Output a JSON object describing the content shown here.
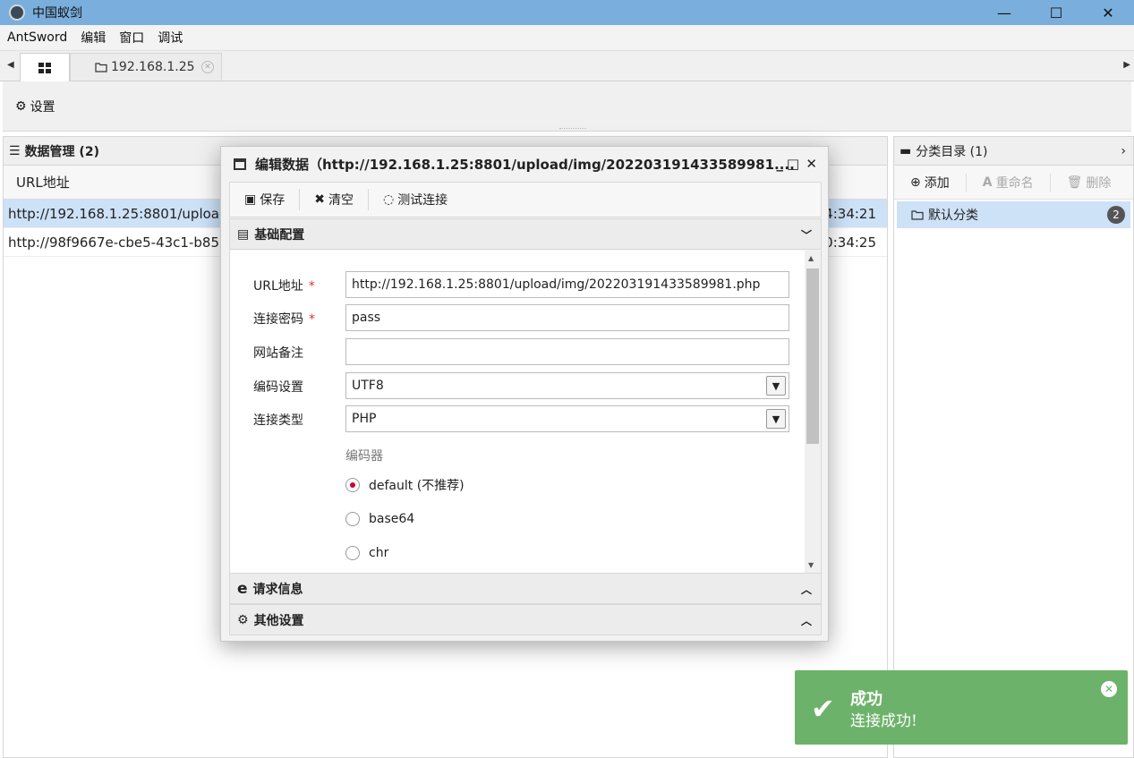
{
  "window": {
    "title": "中国蚁剑",
    "minimize": "—",
    "maximize": "☐",
    "close": "✕"
  },
  "menu": [
    "AntSword",
    "编辑",
    "窗口",
    "调试"
  ],
  "tabs": {
    "host_label": "192.168.1.25"
  },
  "toolbar": {
    "settings_label": "设置"
  },
  "data_panel": {
    "title": "数据管理 (2)",
    "column_url": "URL地址",
    "rows": [
      {
        "url": "http://192.168.1.25:8801/upload/",
        "time": "4:34:21"
      },
      {
        "url": "http://98f9667e-cbe5-43c1-b850-",
        "time": "0:34:25"
      }
    ]
  },
  "category_panel": {
    "title": "分类目录 (1)",
    "add": "添加",
    "rename": "重命名",
    "delete": "删除",
    "items": [
      {
        "name": "默认分类",
        "count": "2"
      }
    ]
  },
  "modal": {
    "title": "编辑数据（http://192.168.1.25:8801/upload/img/202203191433589981....",
    "save": "保存",
    "clear": "清空",
    "test": "测试连接",
    "basic_section": "基础配置",
    "request_section": "请求信息",
    "other_section": "其他设置",
    "fields": {
      "url_label": "URL地址",
      "url_value": "http://192.168.1.25:8801/upload/img/202203191433589981.php",
      "password_label": "连接密码",
      "password_value": "pass",
      "note_label": "网站备注",
      "note_value": "",
      "encoding_label": "编码设置",
      "encoding_value": "UTF8",
      "type_label": "连接类型",
      "type_value": "PHP",
      "required_mark": "*"
    },
    "encoder": {
      "title": "编码器",
      "options": [
        "default (不推荐)",
        "base64",
        "chr"
      ],
      "selected": "default (不推荐)"
    }
  },
  "toast": {
    "title": "成功",
    "message": "连接成功!"
  },
  "colors": {
    "titlebar": "#7aaedc",
    "selection": "#cde1f7",
    "toast": "#6db26a"
  }
}
